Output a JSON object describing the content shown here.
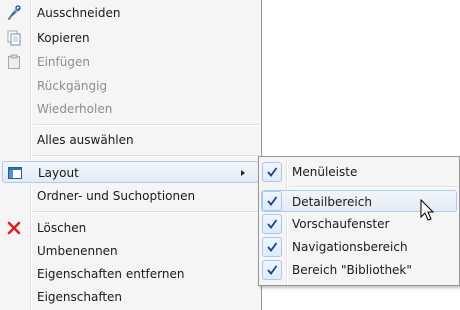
{
  "context_menu": {
    "items": [
      {
        "label": "Ausschneiden",
        "icon": "scissors-icon",
        "enabled": true
      },
      {
        "label": "Kopieren",
        "icon": "copy-icon",
        "enabled": true
      },
      {
        "label": "Einfügen",
        "icon": "paste-icon",
        "enabled": false
      },
      {
        "label": "Rückgängig",
        "enabled": false
      },
      {
        "label": "Wiederholen",
        "enabled": false
      },
      {
        "label": "Alles auswählen",
        "enabled": true
      },
      {
        "label": "Layout",
        "icon": "layout-icon",
        "enabled": true,
        "has_submenu": true,
        "highlighted": true
      },
      {
        "label": "Ordner- und Suchoptionen",
        "enabled": true
      },
      {
        "label": "Löschen",
        "icon": "delete-x-icon",
        "enabled": true
      },
      {
        "label": "Umbenennen",
        "enabled": true
      },
      {
        "label": "Eigenschaften entfernen",
        "enabled": true
      },
      {
        "label": "Eigenschaften",
        "enabled": true
      }
    ]
  },
  "layout_submenu": {
    "items": [
      {
        "label": "Menüleiste",
        "checked": true
      },
      {
        "label": "Detailbereich",
        "checked": true,
        "highlighted": true
      },
      {
        "label": "Vorschaufenster",
        "checked": true
      },
      {
        "label": "Navigationsbereich",
        "checked": true
      },
      {
        "label": "Bereich \"Bibliothek\"",
        "checked": true
      }
    ]
  },
  "colors": {
    "menu_background": "#f5f5f5",
    "highlight_border": "#aecbee",
    "disabled_text": "#8d8d8d",
    "checkmark": "#1f3d99",
    "delete_icon": "#e02020"
  }
}
